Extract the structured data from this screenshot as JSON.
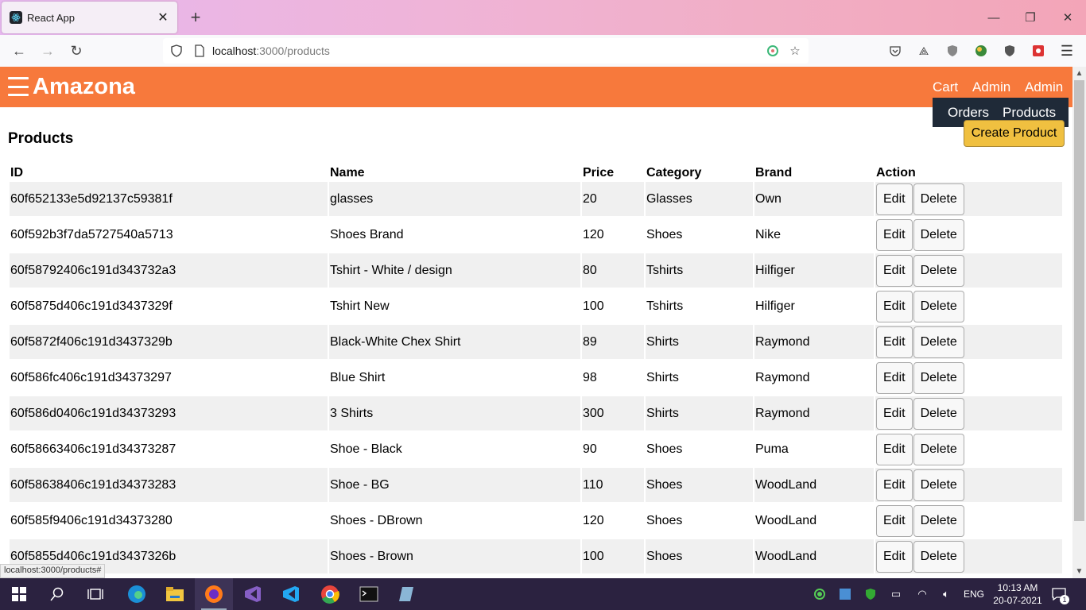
{
  "browser": {
    "tab_title": "React App",
    "url_host": "localhost",
    "url_path": ":3000/products",
    "status_text": "localhost:3000/products#"
  },
  "app": {
    "brand": "Amazona",
    "nav": {
      "cart": "Cart",
      "admin_1": "Admin",
      "admin_2": "Admin"
    },
    "dropdown": {
      "orders": "Orders",
      "products": "Products"
    }
  },
  "page": {
    "title": "Products",
    "create_label": "Create Product"
  },
  "table": {
    "headers": [
      "ID",
      "Name",
      "Price",
      "Category",
      "Brand",
      "Action"
    ],
    "edit_label": "Edit",
    "delete_label": "Delete",
    "rows": [
      {
        "id": "60f652133e5d92137c59381f",
        "name": "glasses",
        "price": "20",
        "category": "Glasses",
        "brand": "Own"
      },
      {
        "id": "60f592b3f7da5727540a5713",
        "name": "Shoes Brand",
        "price": "120",
        "category": "Shoes",
        "brand": "Nike"
      },
      {
        "id": "60f58792406c191d343732a3",
        "name": "Tshirt - White / design",
        "price": "80",
        "category": "Tshirts",
        "brand": "Hilfiger"
      },
      {
        "id": "60f5875d406c191d3437329f",
        "name": "Tshirt New",
        "price": "100",
        "category": "Tshirts",
        "brand": "Hilfiger"
      },
      {
        "id": "60f5872f406c191d3437329b",
        "name": "Black-White Chex Shirt",
        "price": "89",
        "category": "Shirts",
        "brand": "Raymond"
      },
      {
        "id": "60f586fc406c191d34373297",
        "name": "Blue Shirt",
        "price": "98",
        "category": "Shirts",
        "brand": "Raymond"
      },
      {
        "id": "60f586d0406c191d34373293",
        "name": "3 Shirts",
        "price": "300",
        "category": "Shirts",
        "brand": "Raymond"
      },
      {
        "id": "60f58663406c191d34373287",
        "name": "Shoe - Black",
        "price": "90",
        "category": "Shoes",
        "brand": "Puma"
      },
      {
        "id": "60f58638406c191d34373283",
        "name": "Shoe - BG",
        "price": "110",
        "category": "Shoes",
        "brand": "WoodLand"
      },
      {
        "id": "60f585f9406c191d34373280",
        "name": "Shoes - DBrown",
        "price": "120",
        "category": "Shoes",
        "brand": "WoodLand"
      },
      {
        "id": "60f5855d406c191d3437326b",
        "name": "Shoes - Brown",
        "price": "100",
        "category": "Shoes",
        "brand": "WoodLand"
      }
    ]
  },
  "taskbar": {
    "language": "ENG",
    "time": "10:13 AM",
    "date": "20-07-2021",
    "notification_count": "1"
  },
  "colors": {
    "header": "#f7793c",
    "dropdown": "#1f2a38",
    "create_button": "#f0c040",
    "row_stripe": "#f0f0f0"
  }
}
